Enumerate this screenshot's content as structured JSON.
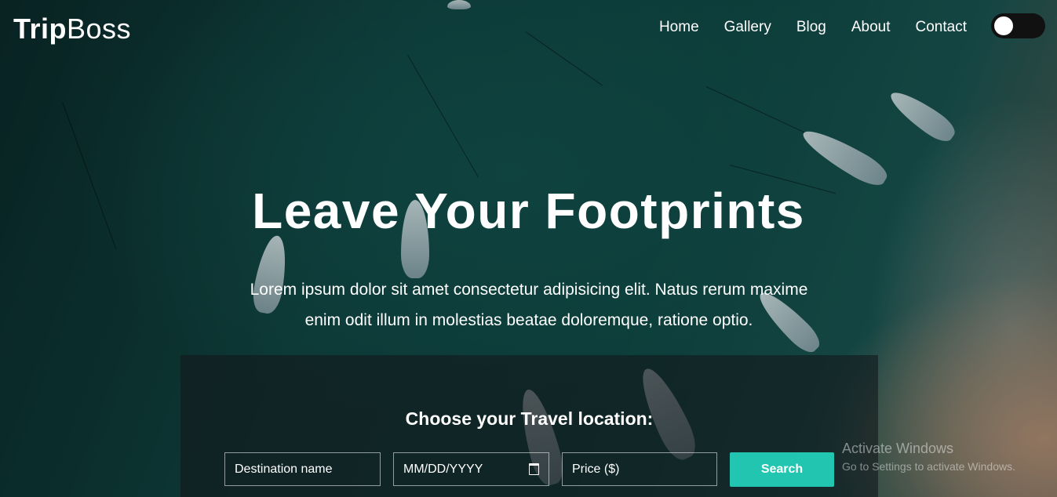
{
  "brand": {
    "bold": "Trip",
    "light": "Boss"
  },
  "nav": [
    {
      "label": "Home"
    },
    {
      "label": "Gallery"
    },
    {
      "label": "Blog"
    },
    {
      "label": "About"
    },
    {
      "label": "Contact"
    }
  ],
  "theme_toggle": {
    "state": "off"
  },
  "hero": {
    "title": "Leave Your Footprints",
    "text": "Lorem ipsum dolor sit amet consectetur adipisicing elit. Natus rerum maxime enim odit illum in molestias beatae doloremque, ratione optio."
  },
  "search": {
    "title": "Choose your Travel location:",
    "destination_placeholder": "Destination name",
    "date_placeholder": "MM/DD/YYYY",
    "price_placeholder": "Price ($)",
    "button_label": "Search"
  },
  "watermark": {
    "line1": "Activate Windows",
    "line2": "Go to Settings to activate Windows."
  },
  "colors": {
    "accent": "#22c6b0",
    "panel": "#14191c",
    "toggle": "#111111"
  }
}
